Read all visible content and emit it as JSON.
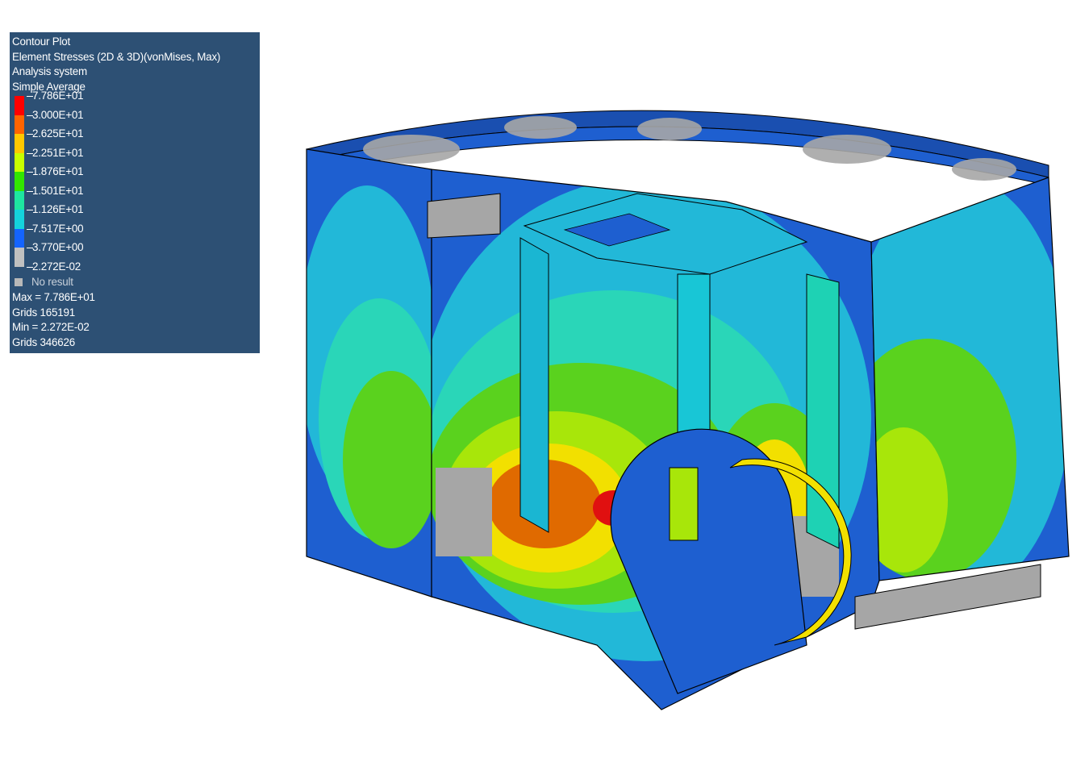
{
  "legend": {
    "title": "Contour Plot",
    "result_type": "Element Stresses (2D & 3D)(vonMises, Max)",
    "coord_system": "Analysis system",
    "averaging": "Simple Average",
    "levels": [
      {
        "label": "7.786E+01",
        "color": "#ff0000"
      },
      {
        "label": "3.000E+01",
        "color": "#ff6400"
      },
      {
        "label": "2.625E+01",
        "color": "#ffc800"
      },
      {
        "label": "2.251E+01",
        "color": "#c8ff00"
      },
      {
        "label": "1.876E+01",
        "color": "#32e600"
      },
      {
        "label": "1.501E+01",
        "color": "#1ee6a0"
      },
      {
        "label": "1.126E+01",
        "color": "#14d2dc"
      },
      {
        "label": "7.517E+00",
        "color": "#1464ff"
      },
      {
        "label": "3.770E+00",
        "color": "#c0c0c0"
      },
      {
        "label": "2.272E-02",
        "color": "#c0c0c0"
      }
    ],
    "no_result_label": "No result",
    "max_label": "Max = 7.786E+01",
    "max_grid": "Grids 165191",
    "min_label": "Min = 2.272E-02",
    "min_grid": "Grids 346626"
  },
  "model": {
    "palette": {
      "blue": "#1e5fd0",
      "cyan": "#22b8d8",
      "teal": "#2ad6b8",
      "green": "#5ad21e",
      "lime": "#a8e60a",
      "yellow": "#f2e000",
      "orange": "#e06a00",
      "red": "#e01010",
      "gray": "#a6a6a6"
    }
  }
}
